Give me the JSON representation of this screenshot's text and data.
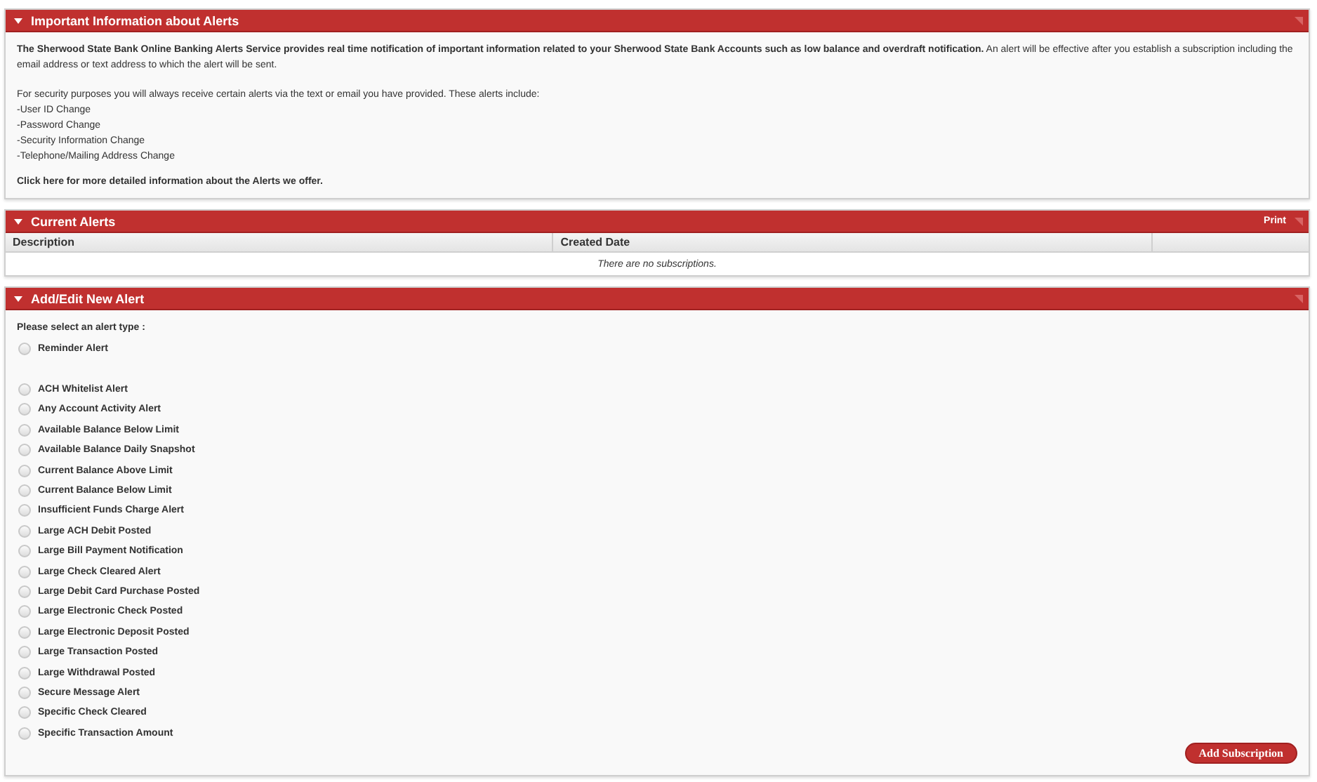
{
  "info_panel": {
    "title": "Important Information about Alerts",
    "expanded": true,
    "intro": "**The Sherwood State Bank Online Banking Alerts Service provides real time notification of important information related to your Sherwood State Bank Accounts such as low balance and overdraft notification.** An alert will be effective after you establish a subscription including the email address or text address to which the alert will be sent.",
    "security_note": "For security purposes you will always receive certain alerts via the text or email you have provided. These alerts include:",
    "security_alerts": [
      "-User ID Change",
      "-Password Change",
      "-Security Information Change",
      "-Telephone/Mailing Address Change"
    ],
    "more_link": "Click here for more detailed information about the Alerts we offer."
  },
  "current_alerts": {
    "title": "Current Alerts",
    "expanded": true,
    "print_link": "Print",
    "table": {
      "columns": [
        "Description",
        "Created Date"
      ],
      "empty_message": "There are no subscriptions."
    }
  },
  "add_edit": {
    "title": "Add/Edit New Alert",
    "expanded": true,
    "prompt": "Please select an alert type :",
    "groups": [
      [
        {
          "label": "Reminder Alert",
          "selected": false
        }
      ],
      [
        {
          "label": "ACH Whitelist Alert",
          "selected": false
        },
        {
          "label": "Any Account Activity Alert",
          "selected": false
        },
        {
          "label": "Available Balance Below Limit",
          "selected": false
        },
        {
          "label": "Available Balance Daily Snapshot",
          "selected": false
        },
        {
          "label": "Current Balance Above Limit",
          "selected": false
        },
        {
          "label": "Current Balance Below Limit",
          "selected": false
        },
        {
          "label": "Insufficient Funds Charge Alert",
          "selected": false
        },
        {
          "label": "Large ACH Debit Posted",
          "selected": false
        },
        {
          "label": "Large Bill Payment Notification",
          "selected": false
        },
        {
          "label": "Large Check Cleared Alert",
          "selected": false
        },
        {
          "label": "Large Debit Card Purchase Posted",
          "selected": false
        },
        {
          "label": "Large Electronic Check Posted",
          "selected": false
        },
        {
          "label": "Large Electronic Deposit Posted",
          "selected": false
        },
        {
          "label": "Large Transaction Posted",
          "selected": false
        },
        {
          "label": "Large Withdrawal Posted",
          "selected": false
        },
        {
          "label": "Secure Message Alert",
          "selected": false
        },
        {
          "label": "Specific Check Cleared",
          "selected": false
        },
        {
          "label": "Specific Transaction Amount",
          "selected": false
        }
      ]
    ],
    "submit_button": "Add Subscription"
  }
}
